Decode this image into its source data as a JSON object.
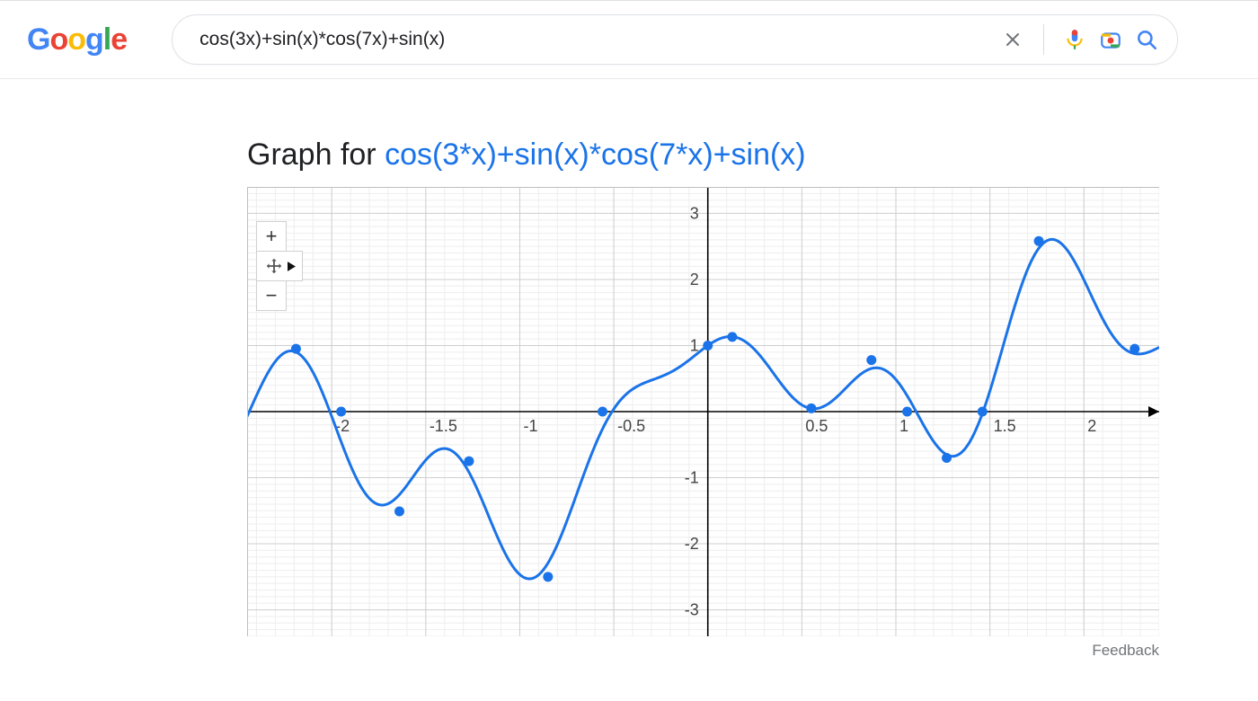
{
  "search": {
    "value": "cos(3x)+sin(x)*cos(7x)+sin(x)"
  },
  "graph": {
    "title_prefix": "Graph for ",
    "title_expr": "cos(3*x)+sin(x)*cos(7*x)+sin(x)",
    "feedback": "Feedback"
  },
  "controls": {
    "zoom_in": "+",
    "zoom_out": "−"
  },
  "chart_data": {
    "type": "line",
    "title": "Graph for cos(3*x)+sin(x)*cos(7*x)+sin(x)",
    "function": "cos(3*x)+sin(x)*cos(7*x)+sin(x)",
    "xlabel": "",
    "ylabel": "",
    "xlim": [
      -2.45,
      2.4
    ],
    "ylim": [
      -3.4,
      3.4
    ],
    "x_ticks": [
      -2,
      -1.5,
      -1,
      -0.5,
      0.5,
      1,
      1.5,
      2
    ],
    "y_ticks": [
      -3,
      -2,
      -1,
      1,
      2,
      3
    ],
    "series": {
      "name": "cos(3*x)+sin(x)*cos(7*x)+sin(x)",
      "color": "#1a73e8",
      "markers_at_extrema": true,
      "approx_extrema": [
        {
          "x": -2.19,
          "y": 0.95
        },
        {
          "x": -1.95,
          "y": 0.0
        },
        {
          "x": -1.64,
          "y": -1.51
        },
        {
          "x": -1.27,
          "y": -0.75
        },
        {
          "x": -0.85,
          "y": -2.5
        },
        {
          "x": -0.56,
          "y": 0.0
        },
        {
          "x": 0.0,
          "y": 1.0
        },
        {
          "x": 0.13,
          "y": 1.13
        },
        {
          "x": 0.55,
          "y": 0.05
        },
        {
          "x": 0.87,
          "y": 0.78
        },
        {
          "x": 1.06,
          "y": 0.0
        },
        {
          "x": 1.27,
          "y": -0.7
        },
        {
          "x": 1.46,
          "y": 0.0
        },
        {
          "x": 1.76,
          "y": 2.58
        },
        {
          "x": 2.27,
          "y": 0.95
        }
      ]
    }
  }
}
